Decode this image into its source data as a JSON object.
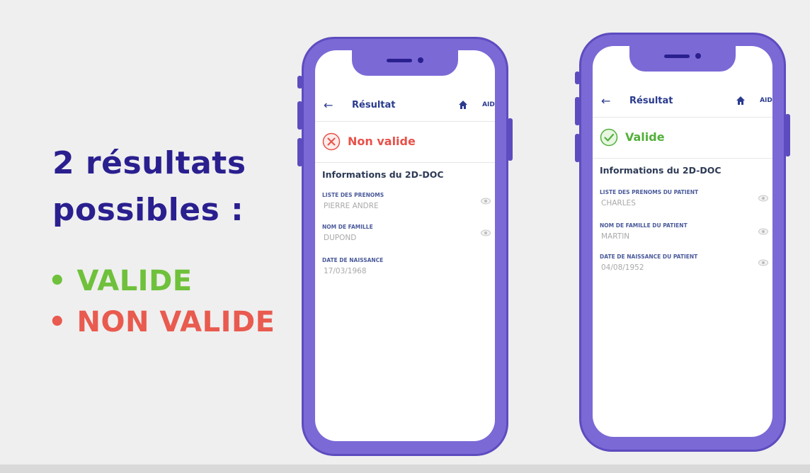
{
  "headline": {
    "line1": "2 résultats",
    "line2": "possibles :"
  },
  "bullets": {
    "valid": "• VALIDE",
    "invalid": "• NON VALIDE"
  },
  "phones": [
    {
      "title": "Résultat",
      "help": "AIDE",
      "status": "Non valide",
      "status_type": "invalid",
      "section_title": "Informations du 2D-DOC",
      "fields": [
        {
          "label": "LISTE DES PRENOMS",
          "value": "PIERRE ANDRE"
        },
        {
          "label": "NOM DE FAMILLE",
          "value": "DUPOND"
        },
        {
          "label": "DATE DE NAISSANCE",
          "value": "17/03/1968"
        }
      ]
    },
    {
      "title": "Résultat",
      "help": "AIDE",
      "status": "Valide",
      "status_type": "valid",
      "section_title": "Informations du 2D-DOC",
      "fields": [
        {
          "label": "LISTE DES PRENOMS DU PATIENT",
          "value": "CHARLES"
        },
        {
          "label": "NOM DE FAMILLE DU PATIENT",
          "value": "MARTIN"
        },
        {
          "label": "DATE DE NAISSANCE DU PATIENT",
          "value": "04/08/1952"
        }
      ]
    }
  ],
  "colors": {
    "headline": "#2a1f8f",
    "valid": "#6fc13b",
    "invalid": "#e95a4f",
    "phone": "#7b69d6"
  },
  "icons": {
    "back": "arrow-left-icon",
    "home": "home-icon",
    "invalid": "x-circle-icon",
    "valid": "check-circle-icon",
    "eye": "eye-icon"
  }
}
